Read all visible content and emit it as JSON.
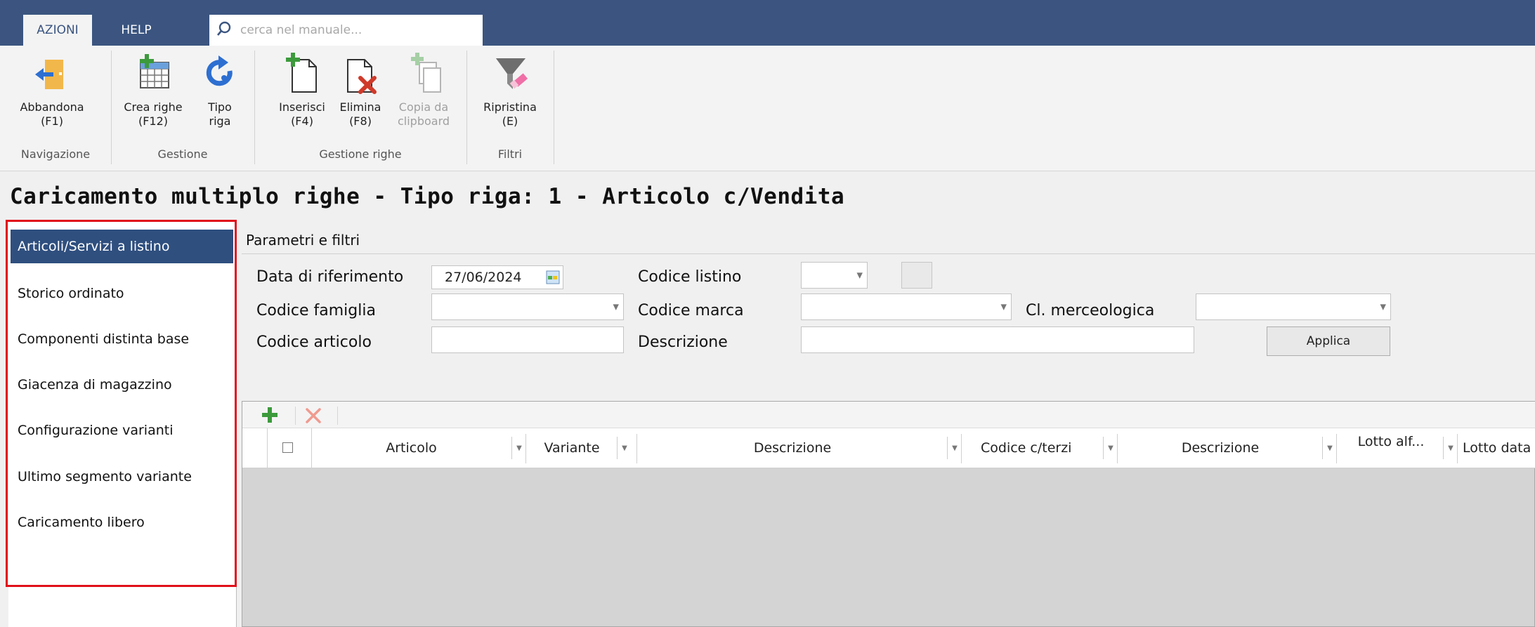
{
  "tabs": [
    {
      "label": "AZIONI",
      "active": true
    },
    {
      "label": "HELP",
      "active": false
    }
  ],
  "search": {
    "placeholder": "cerca nel manuale..."
  },
  "ribbon": {
    "buttons": [
      {
        "label": "Abbandona",
        "shortcut": "(F1)",
        "icon": "exit-icon"
      },
      {
        "label": "Crea righe",
        "shortcut": "(F12)",
        "icon": "grid-add-icon"
      },
      {
        "label": "Tipo",
        "shortcut": "riga",
        "icon": "refresh-icon"
      },
      {
        "label": "Inserisci",
        "shortcut": "(F4)",
        "icon": "page-add-icon"
      },
      {
        "label": "Elimina",
        "shortcut": "(F8)",
        "icon": "page-delete-icon"
      },
      {
        "label": "Copia da",
        "shortcut": "clipboard",
        "icon": "copy-clipboard-icon",
        "disabled": true
      },
      {
        "label": "Ripristina",
        "shortcut": "(E)",
        "icon": "filter-reset-icon"
      }
    ],
    "groups": [
      "Navigazione",
      "Gestione",
      "Gestione righe",
      "Filtri"
    ]
  },
  "page_title": "Caricamento multiplo righe - Tipo riga: 1 - Articolo c/Vendita",
  "leftnav": {
    "items": [
      "Articoli/Servizi a listino",
      "Storico ordinato",
      "Componenti distinta base",
      "Giacenza di magazzino",
      "Configurazione varianti",
      "Ultimo segmento variante",
      "Caricamento libero"
    ],
    "selected_index": 0
  },
  "params": {
    "title": "Parametri e filtri",
    "data_riferimento_label": "Data di riferimento",
    "data_riferimento_value": "27/06/2024",
    "codice_listino_label": "Codice listino",
    "codice_famiglia_label": "Codice famiglia",
    "codice_marca_label": "Codice marca",
    "cl_merceologica_label": "Cl. merceologica",
    "codice_articolo_label": "Codice articolo",
    "descrizione_label": "Descrizione",
    "applica_label": "Applica"
  },
  "grid": {
    "columns": [
      "Articolo",
      "Variante",
      "Descrizione",
      "Codice c/terzi",
      "Descrizione",
      "Lotto alf...",
      "Lotto data"
    ]
  },
  "colors": {
    "accent": "#3b5580",
    "selected": "#2f4f7f",
    "highlight": "#e0101a",
    "arrow": "#9b0d0d"
  }
}
